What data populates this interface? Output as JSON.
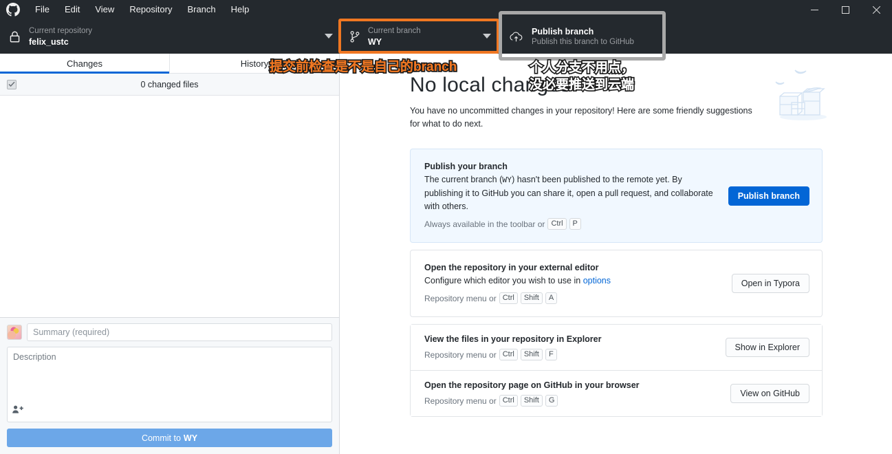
{
  "titlebar": {
    "logo_icon": "github-logo-icon",
    "menu": [
      "File",
      "Edit",
      "View",
      "Repository",
      "Branch",
      "Help"
    ],
    "window_controls": {
      "minimize": "minimize-icon",
      "maximize": "maximize-icon",
      "close": "close-icon"
    }
  },
  "toolbar": {
    "repository": {
      "icon": "lock-icon",
      "label": "Current repository",
      "value": "felix_ustc",
      "caret": "chevron-down-icon"
    },
    "branch": {
      "icon": "git-branch-icon",
      "label": "Current branch",
      "value": "WY",
      "caret": "chevron-down-icon",
      "highlight_color": "#f07722"
    },
    "publish": {
      "icon": "cloud-upload-icon",
      "title": "Publish branch",
      "subtitle": "Publish this branch to GitHub",
      "highlight_color": "#a8a8a8"
    }
  },
  "sidebar": {
    "tabs": [
      {
        "label": "Changes",
        "active": true
      },
      {
        "label": "History",
        "active": false
      }
    ],
    "changed_files_text": "0 changed files",
    "checkbox_checked": true,
    "commit": {
      "avatar": "user-avatar",
      "summary_placeholder": "Summary (required)",
      "summary_value": "",
      "description_placeholder": "Description",
      "description_value": "",
      "coauthor_icon": "person-add-icon",
      "commit_button_prefix": "Commit to ",
      "commit_button_branch": "WY"
    }
  },
  "main": {
    "title": "No local changes",
    "subtitle": "You have no uncommitted changes in your repository! Here are some friendly suggestions for what to do next.",
    "illustration": "boxes-and-birds-illustration",
    "cards": [
      {
        "title": "Publish your branch",
        "desc_before": "The current branch (",
        "desc_branch": "WY",
        "desc_after": ") hasn't been published to the remote yet. By publishing it to GitHub you can share it, open a pull request, and collaborate with others.",
        "foot_text": "Always available in the toolbar or",
        "foot_keys": [
          "Ctrl",
          "P"
        ],
        "button": "Publish branch",
        "button_primary": true,
        "highlight": true
      },
      {
        "title": "Open the repository in your external editor",
        "desc_before": "Configure which editor you wish to use in ",
        "desc_link": "options",
        "foot_text": "Repository menu or",
        "foot_keys": [
          "Ctrl",
          "Shift",
          "A"
        ],
        "button": "Open in Typora",
        "button_primary": false,
        "highlight": false
      },
      {
        "title": "View the files in your repository in Explorer",
        "foot_text": "Repository menu or",
        "foot_keys": [
          "Ctrl",
          "Shift",
          "F"
        ],
        "button": "Show in Explorer",
        "button_primary": false,
        "highlight": false
      },
      {
        "title": "Open the repository page on GitHub in your browser",
        "foot_text": "Repository menu or",
        "foot_keys": [
          "Ctrl",
          "Shift",
          "G"
        ],
        "button": "View on GitHub",
        "button_primary": false,
        "highlight": false
      }
    ]
  },
  "annotations": [
    {
      "text": "提交前检查是不是自己的branch",
      "color": "#f07722",
      "outline": "#1a1a1a"
    },
    {
      "line1": "个人分支不用点，",
      "line2": "没必要推送到云端",
      "color": "#ffffff",
      "outline": "#1a1a1a"
    }
  ]
}
